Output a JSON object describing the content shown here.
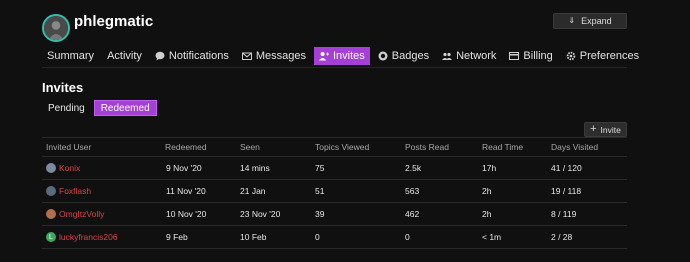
{
  "header": {
    "username": "phlegmatic",
    "avatar_icon": "user-avatar",
    "expand_label": "Expand"
  },
  "nav": {
    "items": [
      {
        "label": "Summary",
        "icon": ""
      },
      {
        "label": "Activity",
        "icon": ""
      },
      {
        "label": "Notifications",
        "icon": "comment-icon"
      },
      {
        "label": "Messages",
        "icon": "envelope-icon"
      },
      {
        "label": "Invites",
        "icon": "user-plus-icon",
        "active": true
      },
      {
        "label": "Badges",
        "icon": "certificate-icon"
      },
      {
        "label": "Network",
        "icon": "users-icon"
      },
      {
        "label": "Billing",
        "icon": "credit-card-icon"
      },
      {
        "label": "Preferences",
        "icon": "cog-icon"
      }
    ]
  },
  "section_title": "Invites",
  "subtabs": [
    {
      "label": "Pending",
      "active": false
    },
    {
      "label": "Redeemed",
      "active": true
    }
  ],
  "invite_button": "Invite",
  "table": {
    "columns": [
      "Invited User",
      "Redeemed",
      "Seen",
      "Topics Viewed",
      "Posts Read",
      "Read Time",
      "Days Visited"
    ],
    "rows": [
      {
        "user": "Konix",
        "redeemed": "9 Nov '20",
        "seen": "14 mins",
        "topics": "75",
        "posts": "2.5k",
        "read_time": "17h",
        "days": "41 / 120",
        "avatar_color": "#7a8aa0",
        "avatar_letter": ""
      },
      {
        "user": "Foxflash",
        "redeemed": "11 Nov '20",
        "seen": "21 Jan",
        "topics": "51",
        "posts": "563",
        "read_time": "2h",
        "days": "19 / 118",
        "avatar_color": "#5a6a80",
        "avatar_letter": ""
      },
      {
        "user": "OmgItzVolly",
        "redeemed": "10 Nov '20",
        "seen": "23 Nov '20",
        "topics": "39",
        "posts": "462",
        "read_time": "2h",
        "days": "8 / 119",
        "avatar_color": "#b07050",
        "avatar_letter": ""
      },
      {
        "user": "luckyfrancis206",
        "redeemed": "9 Feb",
        "seen": "10 Feb",
        "topics": "0",
        "posts": "0",
        "read_time": "< 1m",
        "days": "2 / 28",
        "avatar_color": "#3ea861",
        "avatar_letter": "L"
      }
    ]
  },
  "colors": {
    "accent": "#a440d6",
    "user_link": "#d9434a",
    "background": "#101010"
  }
}
